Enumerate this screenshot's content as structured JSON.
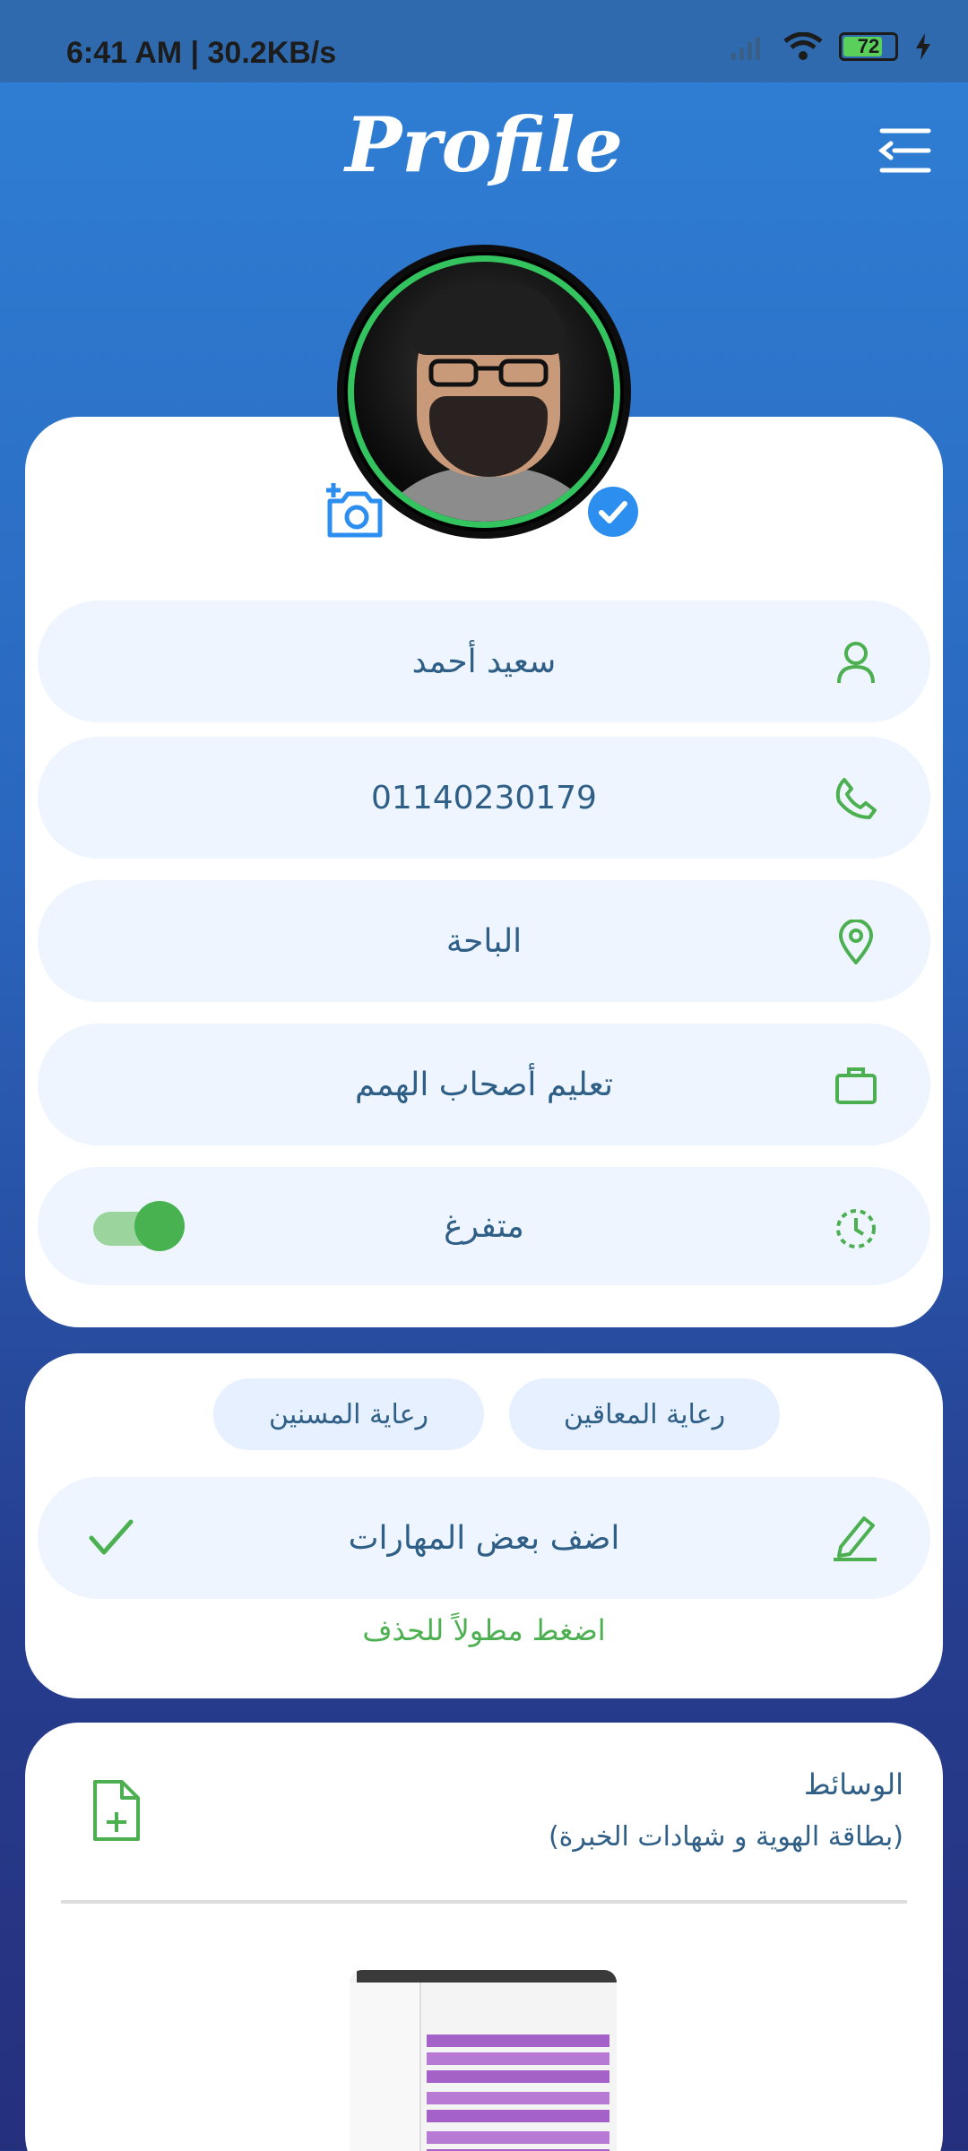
{
  "status_bar": {
    "time": "6:41 AM | 30.2KB/s",
    "battery": "72"
  },
  "header": {
    "title": "Profile"
  },
  "profile": {
    "name": "سعيد أحمد",
    "phone": "01140230179",
    "location": "الباحة",
    "job": "تعليم أصحاب الهمم",
    "availability": "متفرغ",
    "availability_on": true
  },
  "skills": {
    "chips": [
      "رعاية المعاقين",
      "رعاية المسنين"
    ],
    "add_label": "اضف بعض المهارات",
    "hint": "اضغط مطولاً للحذف"
  },
  "media": {
    "title": "الوسائط",
    "subtitle": "(بطاقة الهوية و شهادات الخبرة)"
  },
  "colors": {
    "accent_green": "#4caf50",
    "primary_blue": "#2f80d6",
    "verified_blue": "#2c8ff0"
  },
  "icons": {
    "menu": "menu-back-icon",
    "add_photo": "add-photo-icon",
    "verified": "verified-check-icon",
    "person": "person-icon",
    "phone": "phone-icon",
    "location": "location-pin-icon",
    "job": "briefcase-icon",
    "availability": "clock-dashed-icon",
    "edit": "pencil-icon",
    "confirm": "check-icon",
    "add_file": "file-add-icon"
  }
}
